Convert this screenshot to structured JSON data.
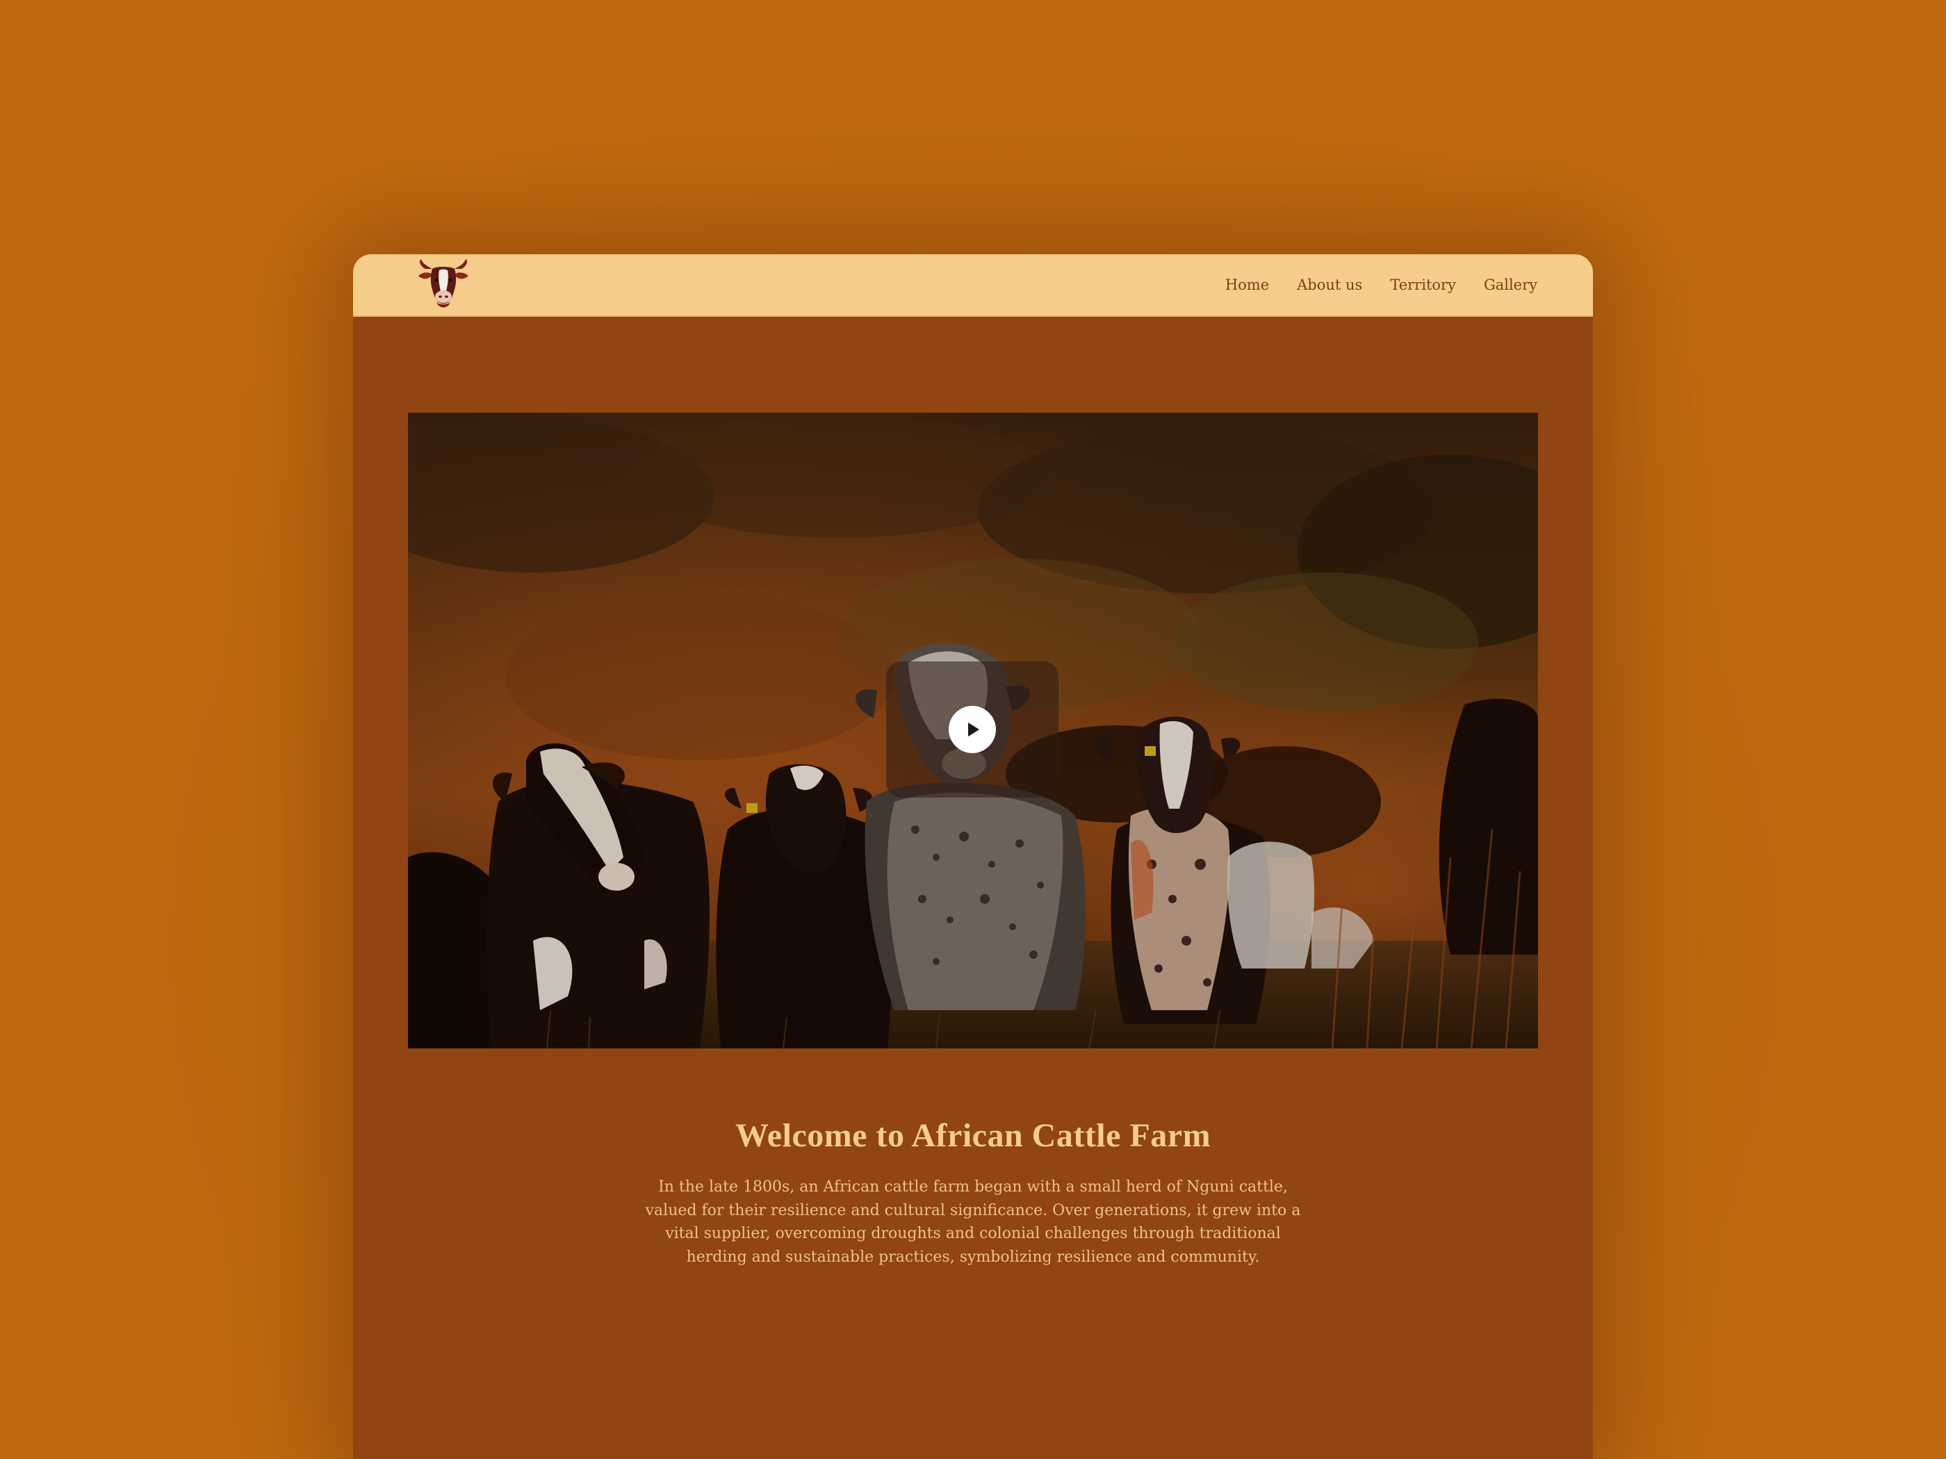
{
  "colors": {
    "page_background": "#c06a10",
    "window_background": "#904513",
    "navbar_background": "#f6cd8a",
    "nav_text": "#7b3f14",
    "heading_text": "#f6cd8a",
    "body_text": "#f0c08c"
  },
  "navbar": {
    "logo_icon": "cow-head-icon",
    "links": [
      {
        "label": "Home"
      },
      {
        "label": "About us"
      },
      {
        "label": "Territory"
      },
      {
        "label": "Gallery"
      }
    ]
  },
  "hero": {
    "image_subject": "herd of cattle in grassland at sunset",
    "play_icon": "play-icon"
  },
  "welcome": {
    "title": "Welcome to African Cattle Farm",
    "body": "In the late 1800s, an African cattle farm began with a small herd of Nguni cattle, valued for their resilience and cultural significance. Over generations, it grew into a vital supplier, overcoming droughts and colonial challenges through traditional herding and sustainable practices, symbolizing resilience and community."
  }
}
